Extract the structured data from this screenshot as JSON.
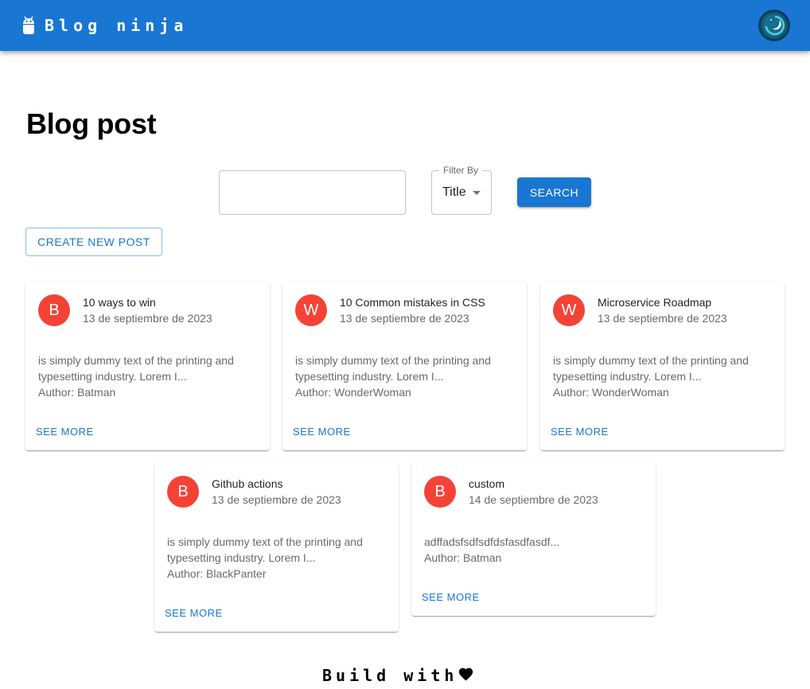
{
  "header": {
    "brand": "Blog ninja",
    "logo_icon": "android-icon",
    "theme_toggle_icon": "dark-mode-toggle-icon",
    "color": "#1976d2"
  },
  "page": {
    "title": "Blog post"
  },
  "filters": {
    "search_value": "",
    "filter_label": "Filter By",
    "filter_value": "Title",
    "search_label": "SEARCH"
  },
  "actions": {
    "create_label": "CREATE NEW POST"
  },
  "posts": [
    {
      "initial": "B",
      "avatar_color": "#f44336",
      "title": "10 ways to win",
      "date": "13 de septiembre de 2023",
      "excerpt": "is simply dummy text of the printing and typesetting industry. Lorem I...",
      "author": "Author: Batman",
      "action": "SEE MORE"
    },
    {
      "initial": "W",
      "avatar_color": "#f44336",
      "title": "10 Common mistakes in CSS",
      "date": "13 de septiembre de 2023",
      "excerpt": "is simply dummy text of the printing and typesetting industry. Lorem I...",
      "author": "Author: WonderWoman",
      "action": "SEE MORE"
    },
    {
      "initial": "W",
      "avatar_color": "#f44336",
      "title": "Microservice Roadmap",
      "date": "13 de septiembre de 2023",
      "excerpt": "is simply dummy text of the printing and typesetting industry. Lorem I...",
      "author": "Author: WonderWoman",
      "action": "SEE MORE"
    },
    {
      "initial": "B",
      "avatar_color": "#f44336",
      "title": "Github actions",
      "date": "13 de septiembre de 2023",
      "excerpt": "is simply dummy text of the printing and typesetting industry. Lorem I...",
      "author": "Author: BlackPanter",
      "action": "SEE MORE"
    },
    {
      "initial": "B",
      "avatar_color": "#f44336",
      "title": "custom",
      "date": "14 de septiembre de 2023",
      "excerpt": "adffadsfsdfsdfdsfasdfasdf...",
      "author": "Author: Batman",
      "action": "SEE MORE"
    }
  ],
  "footer": {
    "text": "Build with",
    "icon": "heart-icon"
  }
}
